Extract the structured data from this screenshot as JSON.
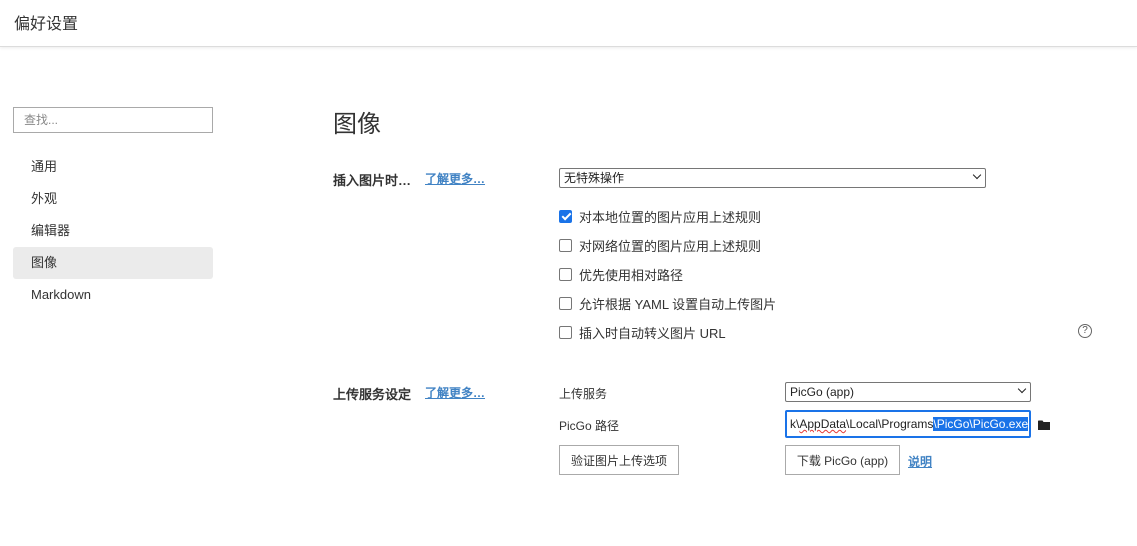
{
  "window": {
    "title": "偏好设置"
  },
  "sidebar": {
    "search_placeholder": "查找...",
    "items": [
      {
        "label": "通用",
        "active": false
      },
      {
        "label": "外观",
        "active": false
      },
      {
        "label": "编辑器",
        "active": false
      },
      {
        "label": "图像",
        "active": true
      },
      {
        "label": "Markdown",
        "active": false
      }
    ]
  },
  "main": {
    "title": "图像",
    "insert_image": {
      "label": "插入图片时…",
      "learn_more": "了解更多…",
      "select_value": "无特殊操作",
      "options": [
        {
          "label": "对本地位置的图片应用上述规则",
          "checked": true
        },
        {
          "label": "对网络位置的图片应用上述规则",
          "checked": false
        },
        {
          "label": "优先使用相对路径",
          "checked": false
        },
        {
          "label": "允许根据 YAML 设置自动上传图片",
          "checked": false
        },
        {
          "label": "插入时自动转义图片 URL",
          "checked": false
        }
      ],
      "help_icon": "question-circle-icon"
    },
    "upload": {
      "label": "上传服务设定",
      "learn_more": "了解更多…",
      "service_label": "上传服务",
      "service_value": "PicGo (app)",
      "path_label": "PicGo 路径",
      "path_prefix": "k\\",
      "path_underlined": "AppData",
      "path_middle": "\\Local\\Programs",
      "path_selected": "\\PicGo\\PicGo.exe",
      "folder_icon": "folder-icon",
      "verify_button": "验证图片上传选项",
      "download_button": "下载 PicGo (app)",
      "explain_link": "说明"
    }
  },
  "colors": {
    "accent": "#1a73e8",
    "link": "#4183c4",
    "active_bg": "#ebebeb"
  }
}
